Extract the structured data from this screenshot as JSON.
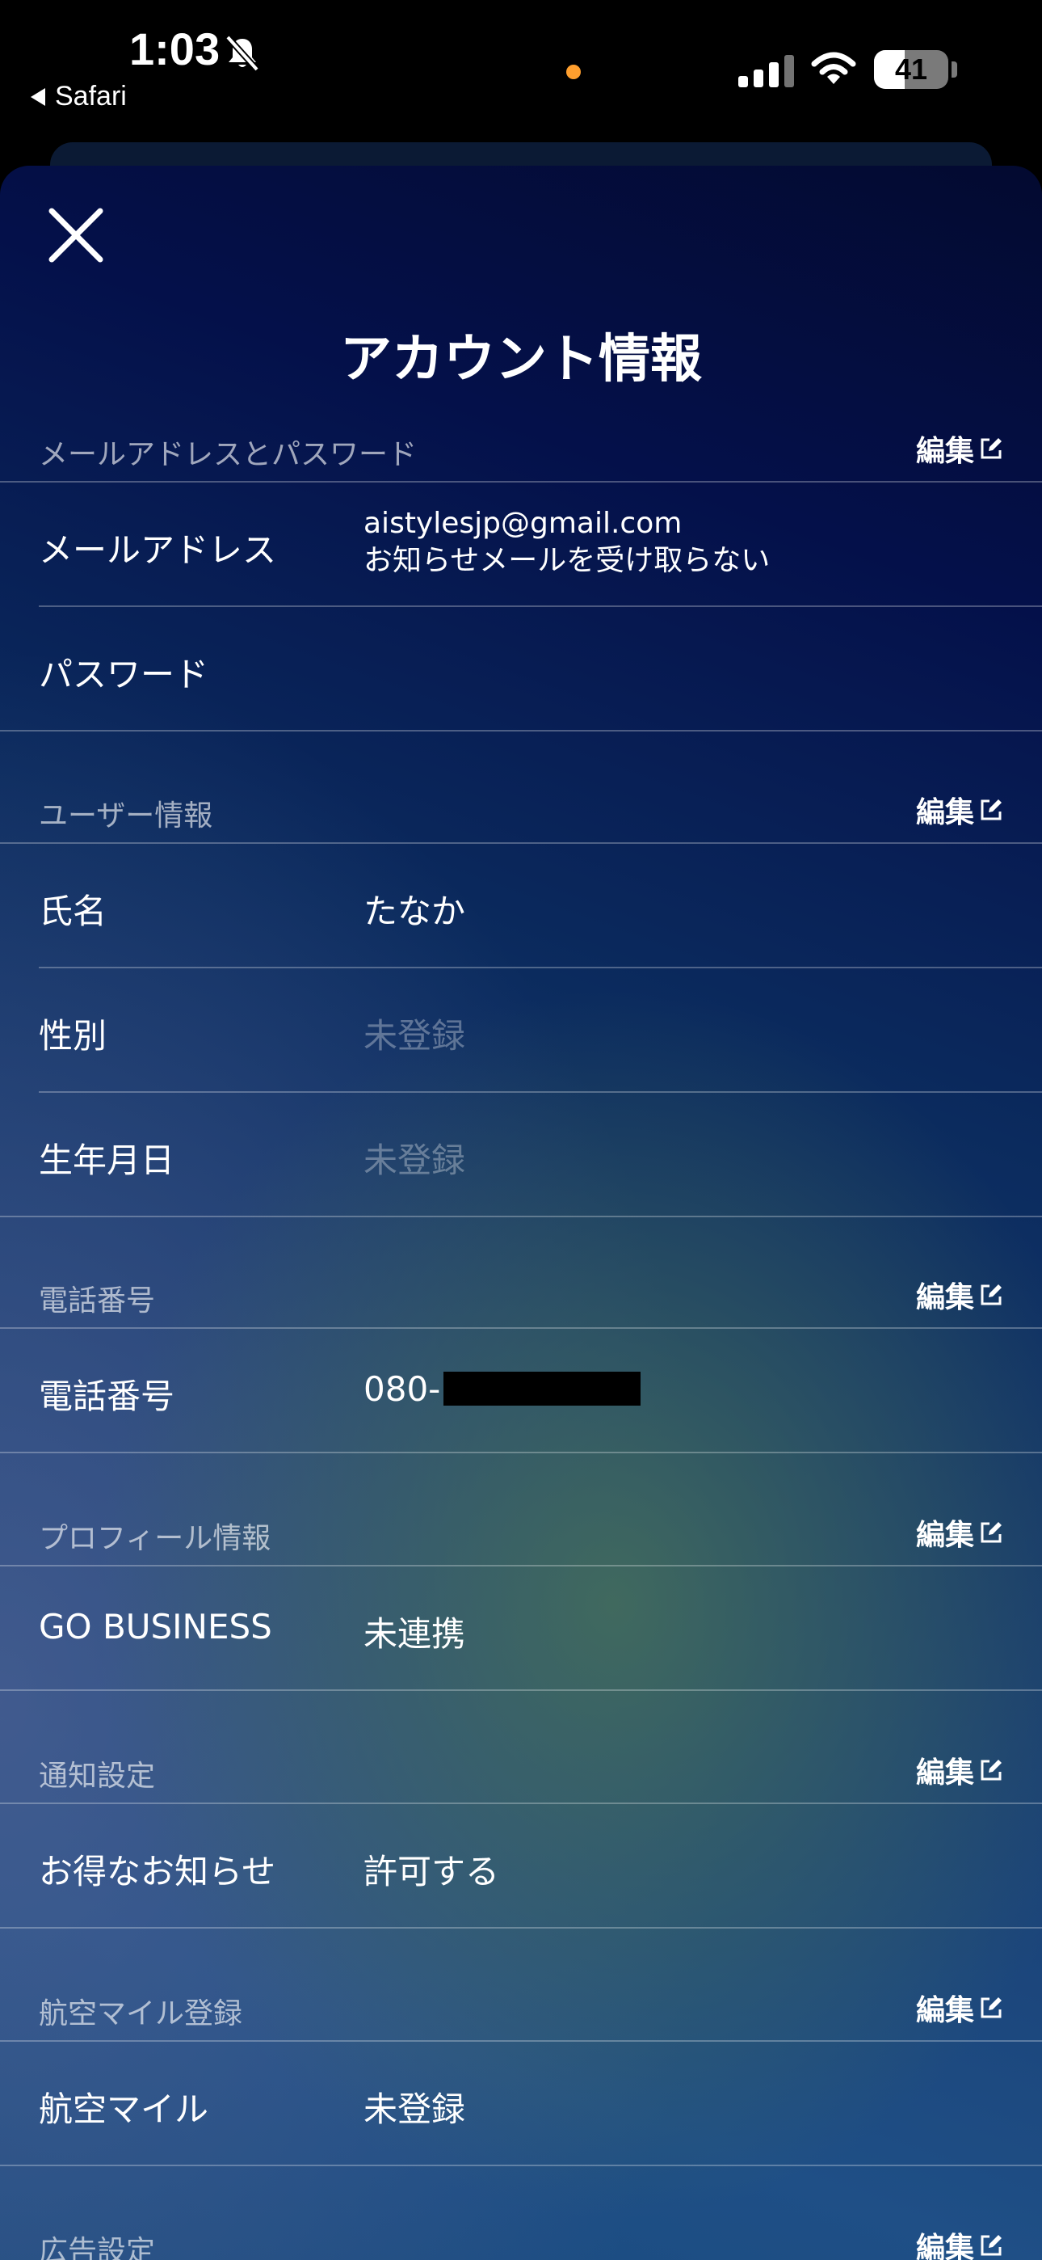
{
  "status_bar": {
    "time": "1:03",
    "back_app": "Safari",
    "battery": "41"
  },
  "page_title": "アカウント情報",
  "edit_label": "編集",
  "sections": {
    "email_password": {
      "title": "メールアドレスとパスワード",
      "rows": [
        {
          "label": "メールアドレス",
          "value": "aistylesjp@gmail.com",
          "value2": "お知らせメールを受け取らない"
        },
        {
          "label": "パスワード",
          "value": ""
        }
      ]
    },
    "user_info": {
      "title": "ユーザー情報",
      "rows": [
        {
          "label": "氏名",
          "value": "たなか"
        },
        {
          "label": "性別",
          "value": "未登録"
        },
        {
          "label": "生年月日",
          "value": "未登録"
        }
      ]
    },
    "phone": {
      "title": "電話番号",
      "rows": [
        {
          "label": "電話番号",
          "value": "080-"
        }
      ]
    },
    "profile": {
      "title": "プロフィール情報",
      "rows": [
        {
          "label": "GO BUSINESS",
          "value": "未連携"
        }
      ]
    },
    "notifications": {
      "title": "通知設定",
      "rows": [
        {
          "label": "お得なお知らせ",
          "value": "許可する"
        }
      ]
    },
    "airline_miles": {
      "title": "航空マイル登録",
      "rows": [
        {
          "label": "航空マイル",
          "value": "未登録"
        }
      ]
    },
    "ads": {
      "title": "広告設定"
    }
  }
}
